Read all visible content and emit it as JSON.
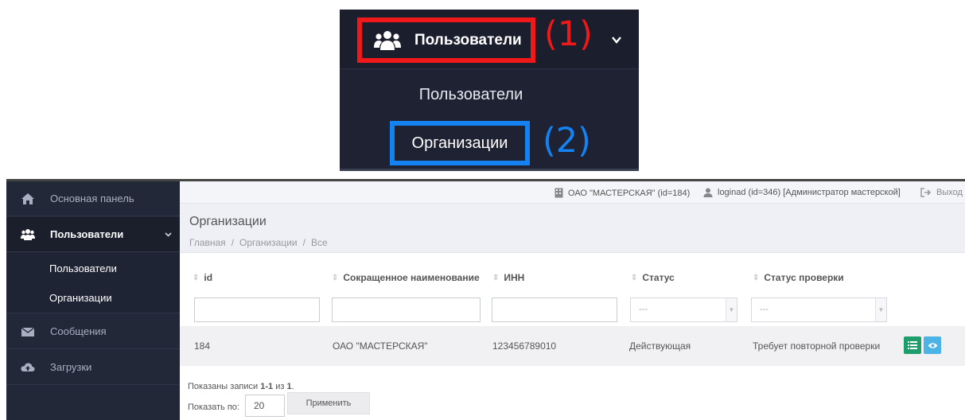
{
  "callout": {
    "menu_label": "Пользователи",
    "marker_1": "(1)",
    "submenu_users": "Пользователи",
    "submenu_orgs": "Организации",
    "marker_2": "(2)",
    "colors": {
      "marker_1": "#f01818",
      "marker_2": "#1482f0"
    }
  },
  "sidebar": {
    "items": [
      {
        "label": "Основная панель",
        "icon": "home-icon"
      },
      {
        "label": "Пользователи",
        "icon": "users-icon",
        "active": true
      },
      {
        "label": "Сообщения",
        "icon": "envelope-icon"
      },
      {
        "label": "Загрузки",
        "icon": "cloud-upload-icon"
      }
    ],
    "subitems": [
      "Пользователи",
      "Организации"
    ]
  },
  "topbar": {
    "org": "ОАО \"МАСТЕРСКАЯ\" (id=184)",
    "user": "loginad (id=346) [Администратор мастерской]",
    "logout": "Выход"
  },
  "page": {
    "title": "Организации",
    "breadcrumb": [
      "Главная",
      "Организации",
      "Все"
    ]
  },
  "table": {
    "columns": [
      "id",
      "Сокращенное наименование",
      "ИНН",
      "Статус",
      "Статус проверки"
    ],
    "filters": {
      "status_placeholder": "---",
      "check_placeholder": "---"
    },
    "rows": [
      {
        "id": "184",
        "name": "ОАО \"МАСТЕРСКАЯ\"",
        "inn": "123456789010",
        "status": "Действующая",
        "check": "Требует повторной проверки"
      }
    ]
  },
  "pagination": {
    "summary_prefix": "Показаны записи ",
    "range": "1-1",
    "summary_mid": " из ",
    "total": "1",
    "summary_suffix": ".",
    "per_page_label": "Показать по:",
    "per_page_value": "20",
    "apply_label": "Применить"
  }
}
